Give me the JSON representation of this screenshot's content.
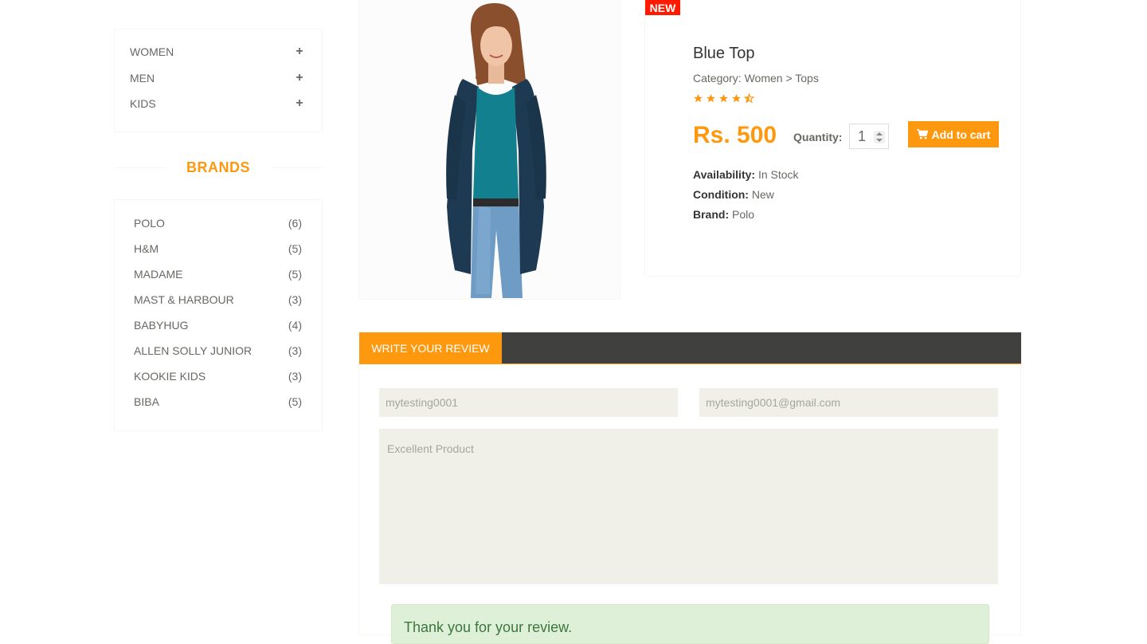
{
  "sidebar": {
    "category_items": [
      {
        "label": "WOMEN",
        "icon": "plus-icon"
      },
      {
        "label": "MEN",
        "icon": "plus-icon"
      },
      {
        "label": "KIDS",
        "icon": "plus-icon"
      }
    ],
    "brands_title": "BRANDS",
    "brands": [
      {
        "name": "POLO",
        "count": "(6)"
      },
      {
        "name": "H&M",
        "count": "(5)"
      },
      {
        "name": "MADAME",
        "count": "(5)"
      },
      {
        "name": "MAST & HARBOUR",
        "count": "(3)"
      },
      {
        "name": "BABYHUG",
        "count": "(4)"
      },
      {
        "name": "ALLEN SOLLY JUNIOR",
        "count": "(3)"
      },
      {
        "name": "KOOKIE KIDS",
        "count": "(3)"
      },
      {
        "name": "BIBA",
        "count": "(5)"
      }
    ]
  },
  "product": {
    "badge": "NEW",
    "name": "Blue Top",
    "category": "Category: Women > Tops",
    "rating": 4.5,
    "price": "Rs. 500",
    "quantity_label": "Quantity:",
    "quantity_value": "1",
    "add_to_cart_label": "Add to cart",
    "availability_label": "Availability:",
    "availability_value": "In Stock",
    "condition_label": "Condition:",
    "condition_value": "New",
    "brand_label": "Brand:",
    "brand_value": "Polo"
  },
  "review": {
    "tab_label": "WRITE YOUR REVIEW",
    "name_value": "mytesting0001",
    "email_value": "mytesting0001@gmail.com",
    "review_text": "Excellent Product",
    "success_message": "Thank you for your review."
  },
  "colors": {
    "accent": "#FE980F",
    "badge_red": "#FF1A00",
    "tab_bar_dark": "#40403E",
    "input_bg": "#F0F0E9",
    "success_bg": "#DFF0D8"
  }
}
